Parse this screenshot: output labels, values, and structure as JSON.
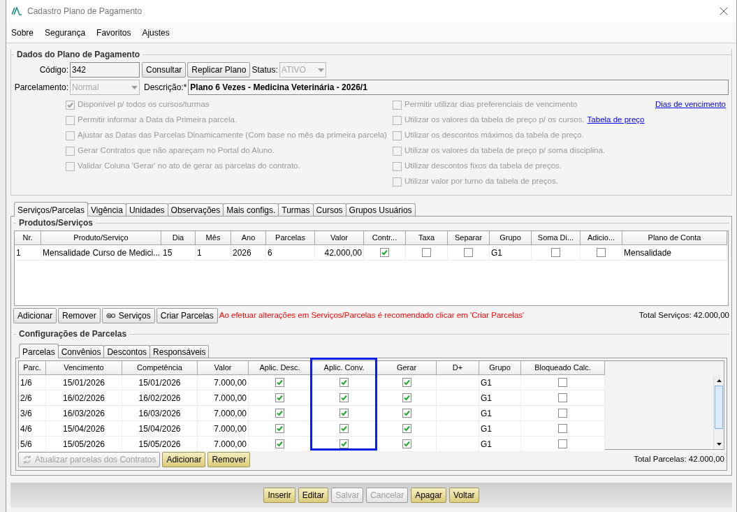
{
  "window": {
    "title": "Cadastro Plano de Pagamento"
  },
  "menu": [
    "Sobre",
    "Segurança",
    "Favoritos",
    "Ajustes"
  ],
  "plan_data": {
    "legend": "Dados do Plano de Pagamento",
    "code_label": "Código:",
    "code_value": "342",
    "consult_button": "Consultar",
    "replicate_button": "Replicar Plano",
    "status_label": "Status:",
    "status_value": "ATIVO",
    "installment_type_label": "Parcelamento:",
    "installment_type_value": "Normal",
    "description_label": "Descrição:*",
    "description_value": "Plano 6 Vezes - Medicina Veterinária - 2026/1",
    "options_left": [
      {
        "label": "Disponível p/ todos os cursos/turmas",
        "checked": true
      },
      {
        "label": "Permitir informar a Data da Primeira parcela.",
        "checked": false
      },
      {
        "label": "Ajustar as Datas das Parcelas Dinamicamente (Com base no mês da primeira parcela)",
        "checked": false
      },
      {
        "label": "Gerar Contratos que não apareçam no Portal do Aluno.",
        "checked": false
      },
      {
        "label": "Validar Coluna 'Gerar' no ato de gerar as parcelas do contrato.",
        "checked": false
      }
    ],
    "options_right": [
      {
        "kind": "link_right",
        "label": "Permitir utilizar dias preferenciais de vencimento",
        "checked": false,
        "link": "Dias de vencimento"
      },
      {
        "kind": "link_inline",
        "label": "Utilizar os valores da tabela de preço p/ os cursos.",
        "checked": false,
        "link": "Tabela de preço"
      },
      {
        "kind": "plain",
        "label": "Utilizar os descontos máximos da tabela de preço.",
        "checked": false
      },
      {
        "kind": "plain",
        "label": "Utilizar os valores da tabela de preço p/ soma disciplina.",
        "checked": false
      },
      {
        "kind": "plain",
        "label": "Utilizar descontos fixos da tabela de preços.",
        "checked": false
      },
      {
        "kind": "plain",
        "label": "Utilizar valor por turno da tabela de preços.",
        "checked": false
      }
    ]
  },
  "tabs": [
    {
      "label": "Serviços/Parcelas",
      "selected": true
    },
    {
      "label": "Vigência",
      "selected": false
    },
    {
      "label": "Unidades",
      "selected": false
    },
    {
      "label": "Observações",
      "selected": false
    },
    {
      "label": "Mais configs.",
      "selected": false
    },
    {
      "label": "Turmas",
      "selected": false
    },
    {
      "label": "Cursos",
      "selected": false
    },
    {
      "label": "Grupos Usuários",
      "selected": false
    }
  ],
  "products": {
    "legend": "Produtos/Serviços",
    "columns": [
      {
        "label": "Nr.",
        "kind": "text"
      },
      {
        "label": "Produto/Serviço",
        "kind": "text"
      },
      {
        "label": "Dia",
        "kind": "text"
      },
      {
        "label": "Mês",
        "kind": "text"
      },
      {
        "label": "Ano",
        "kind": "text"
      },
      {
        "label": "Parcelas",
        "kind": "text"
      },
      {
        "label": "Valor",
        "kind": "number"
      },
      {
        "label": "Contr...",
        "kind": "check"
      },
      {
        "label": "Taxa",
        "kind": "check"
      },
      {
        "label": "Separar",
        "kind": "check"
      },
      {
        "label": "Grupo",
        "kind": "text"
      },
      {
        "label": "Soma Di...",
        "kind": "check"
      },
      {
        "label": "Adicio...",
        "kind": "check"
      },
      {
        "label": "Plano de Conta",
        "kind": "text"
      }
    ],
    "rows": [
      {
        "cells": [
          {
            "text": "1"
          },
          {
            "text": "Mensalidade Curso de Medici..."
          },
          {
            "text": "15"
          },
          {
            "text": "1"
          },
          {
            "text": "2026"
          },
          {
            "text": "6"
          },
          {
            "text": "42.000,00"
          },
          {
            "checked": true
          },
          {
            "checked": false
          },
          {
            "checked": false
          },
          {
            "text": "G1"
          },
          {
            "checked": false
          },
          {
            "checked": false
          },
          {
            "text": "Mensalidade"
          }
        ]
      }
    ],
    "buttons": [
      {
        "label": "Adicionar",
        "kind": "plain"
      },
      {
        "label": "Remover",
        "kind": "plain"
      },
      {
        "label": "Serviços",
        "kind": "icon"
      },
      {
        "label": "Criar Parcelas",
        "kind": "plain"
      }
    ],
    "warning": "Ao efetuar alterações em Serviços/Parcelas é recomendado clicar em 'Criar Parcelas'",
    "total": "Total Serviços: 42.000,00"
  },
  "installments": {
    "legend": "Configurações de Parcelas",
    "tabs": [
      {
        "label": "Parcelas",
        "selected": true
      },
      {
        "label": "Convênios",
        "selected": false
      },
      {
        "label": "Descontos",
        "selected": false
      },
      {
        "label": "Responsáveis",
        "selected": false
      }
    ],
    "columns": [
      {
        "label": "Parc.",
        "kind": "text",
        "highlighted": false
      },
      {
        "label": "Vencimento",
        "kind": "center",
        "highlighted": false
      },
      {
        "label": "Competência",
        "kind": "center",
        "highlighted": false
      },
      {
        "label": "Valor",
        "kind": "number",
        "highlighted": false
      },
      {
        "label": "Aplic. Desc.",
        "kind": "check",
        "highlighted": false
      },
      {
        "label": "Aplic. Conv.",
        "kind": "check",
        "highlighted": true
      },
      {
        "label": "Gerar",
        "kind": "check",
        "highlighted": false
      },
      {
        "label": "D+",
        "kind": "text",
        "highlighted": false
      },
      {
        "label": "Grupo",
        "kind": "text",
        "highlighted": false
      },
      {
        "label": "Bloqueado Calc.",
        "kind": "check",
        "highlighted": false
      }
    ],
    "rows": [
      {
        "cells": [
          {
            "text": "1/6"
          },
          {
            "text": "15/01/2026"
          },
          {
            "text": "15/01/2026"
          },
          {
            "text": "7.000,00"
          },
          {
            "checked": true
          },
          {
            "checked": true
          },
          {
            "checked": true
          },
          {},
          {
            "text": "G1"
          },
          {
            "checked": false
          }
        ]
      },
      {
        "cells": [
          {
            "text": "2/6"
          },
          {
            "text": "16/02/2026"
          },
          {
            "text": "16/02/2026"
          },
          {
            "text": "7.000,00"
          },
          {
            "checked": true
          },
          {
            "checked": true
          },
          {
            "checked": true
          },
          {},
          {
            "text": "G1"
          },
          {
            "checked": false
          }
        ]
      },
      {
        "cells": [
          {
            "text": "3/6"
          },
          {
            "text": "16/03/2026"
          },
          {
            "text": "16/03/2026"
          },
          {
            "text": "7.000,00"
          },
          {
            "checked": true
          },
          {
            "checked": true
          },
          {
            "checked": true
          },
          {},
          {
            "text": "G1"
          },
          {
            "checked": false
          }
        ]
      },
      {
        "cells": [
          {
            "text": "4/6"
          },
          {
            "text": "15/04/2026"
          },
          {
            "text": "15/04/2026"
          },
          {
            "text": "7.000,00"
          },
          {
            "checked": true
          },
          {
            "checked": true
          },
          {
            "checked": true
          },
          {},
          {
            "text": "G1"
          },
          {
            "checked": false
          }
        ]
      },
      {
        "cells": [
          {
            "text": "5/6"
          },
          {
            "text": "15/05/2026"
          },
          {
            "text": "15/05/2026"
          },
          {
            "text": "7.000,00"
          },
          {
            "checked": true
          },
          {
            "checked": true
          },
          {
            "checked": true
          },
          {},
          {
            "text": "G1"
          },
          {
            "checked": false
          }
        ]
      }
    ],
    "buttons": [
      {
        "label": "Atualizar parcelas dos Contratos",
        "kind": "icon",
        "disabled": true
      },
      {
        "label": "Adicionar",
        "kind": "action",
        "disabled": false
      },
      {
        "label": "Remover",
        "kind": "action",
        "disabled": false
      }
    ],
    "total": "Total Parcelas: 42.000,00"
  },
  "footer_buttons": [
    {
      "label": "Inserir",
      "disabled": false
    },
    {
      "label": "Editar",
      "disabled": false
    },
    {
      "label": "Salvar",
      "disabled": true
    },
    {
      "label": "Cancelar",
      "disabled": true
    },
    {
      "label": "Apagar",
      "disabled": false
    },
    {
      "label": "Voltar",
      "disabled": false
    }
  ]
}
